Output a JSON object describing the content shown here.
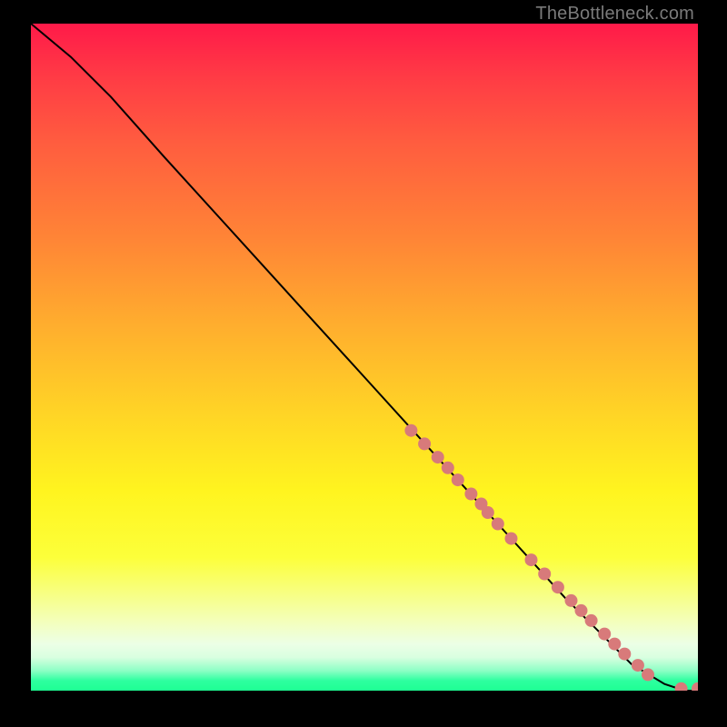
{
  "watermark": "TheBottleneck.com",
  "chart_data": {
    "type": "line",
    "title": "",
    "xlabel": "",
    "ylabel": "",
    "xlim": [
      0,
      100
    ],
    "ylim": [
      0,
      100
    ],
    "series": [
      {
        "name": "curve",
        "x": [
          0,
          6,
          12,
          20,
          30,
          40,
          50,
          60,
          70,
          80,
          90,
          95,
          98,
          100
        ],
        "y": [
          100,
          95,
          89,
          80,
          69,
          58,
          47,
          36,
          25,
          14,
          4,
          1,
          0,
          0
        ]
      }
    ],
    "points": {
      "name": "highlighted-points",
      "color": "#d87a7a",
      "x": [
        57,
        59,
        61,
        62.5,
        64,
        66,
        67.5,
        68.5,
        70,
        72,
        75,
        77,
        79,
        81,
        82.5,
        84,
        86,
        87.5,
        89,
        91,
        92.5,
        97.5,
        100
      ],
      "y": [
        39,
        37,
        35,
        33.4,
        31.6,
        29.5,
        28,
        26.7,
        25,
        22.8,
        19.6,
        17.5,
        15.5,
        13.5,
        12,
        10.5,
        8.5,
        7,
        5.5,
        3.8,
        2.4,
        0.3,
        0.3
      ]
    },
    "gradient_stops": [
      {
        "pos": 0,
        "color": "#ff1a49"
      },
      {
        "pos": 50,
        "color": "#ffd326"
      },
      {
        "pos": 95,
        "color": "#ecffe6"
      },
      {
        "pos": 100,
        "color": "#1eff93"
      }
    ]
  }
}
